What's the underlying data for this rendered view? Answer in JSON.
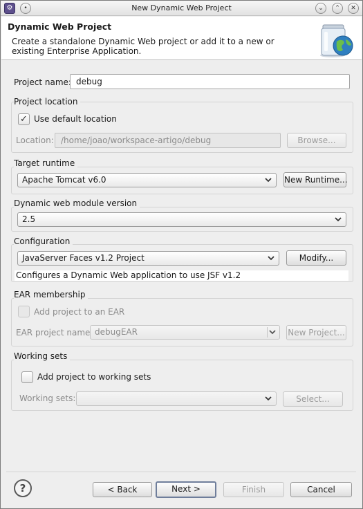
{
  "window": {
    "title": "New Dynamic Web Project"
  },
  "header": {
    "title": "Dynamic Web Project",
    "description": "Create a standalone Dynamic Web project or add it to a new or existing Enterprise Application."
  },
  "project_name": {
    "label": "Project name:",
    "value": "debug"
  },
  "project_location": {
    "group_label": "Project location",
    "use_default_label": "Use default location",
    "use_default_checked": true,
    "location_label": "Location:",
    "location_value": "/home/joao/workspace-artigo/debug",
    "browse_label": "Browse..."
  },
  "target_runtime": {
    "label": "Target runtime",
    "value": "Apache Tomcat v6.0",
    "new_label": "New Runtime..."
  },
  "module_version": {
    "label": "Dynamic web module version",
    "value": "2.5"
  },
  "configuration": {
    "label": "Configuration",
    "value": "JavaServer Faces v1.2 Project",
    "modify_label": "Modify...",
    "description": "Configures a Dynamic Web application to use JSF v1.2"
  },
  "ear": {
    "group_label": "EAR membership",
    "add_label": "Add project to an EAR",
    "add_checked": false,
    "name_label": "EAR project name:",
    "name_value": "debugEAR",
    "new_project_label": "New Project..."
  },
  "working_sets": {
    "group_label": "Working sets",
    "add_label": "Add project to working sets",
    "add_checked": false,
    "sets_label": "Working sets:",
    "sets_value": "",
    "select_label": "Select..."
  },
  "footer": {
    "help_icon": "help-icon",
    "back_label": "< Back",
    "next_label": "Next >",
    "finish_label": "Finish",
    "cancel_label": "Cancel"
  }
}
